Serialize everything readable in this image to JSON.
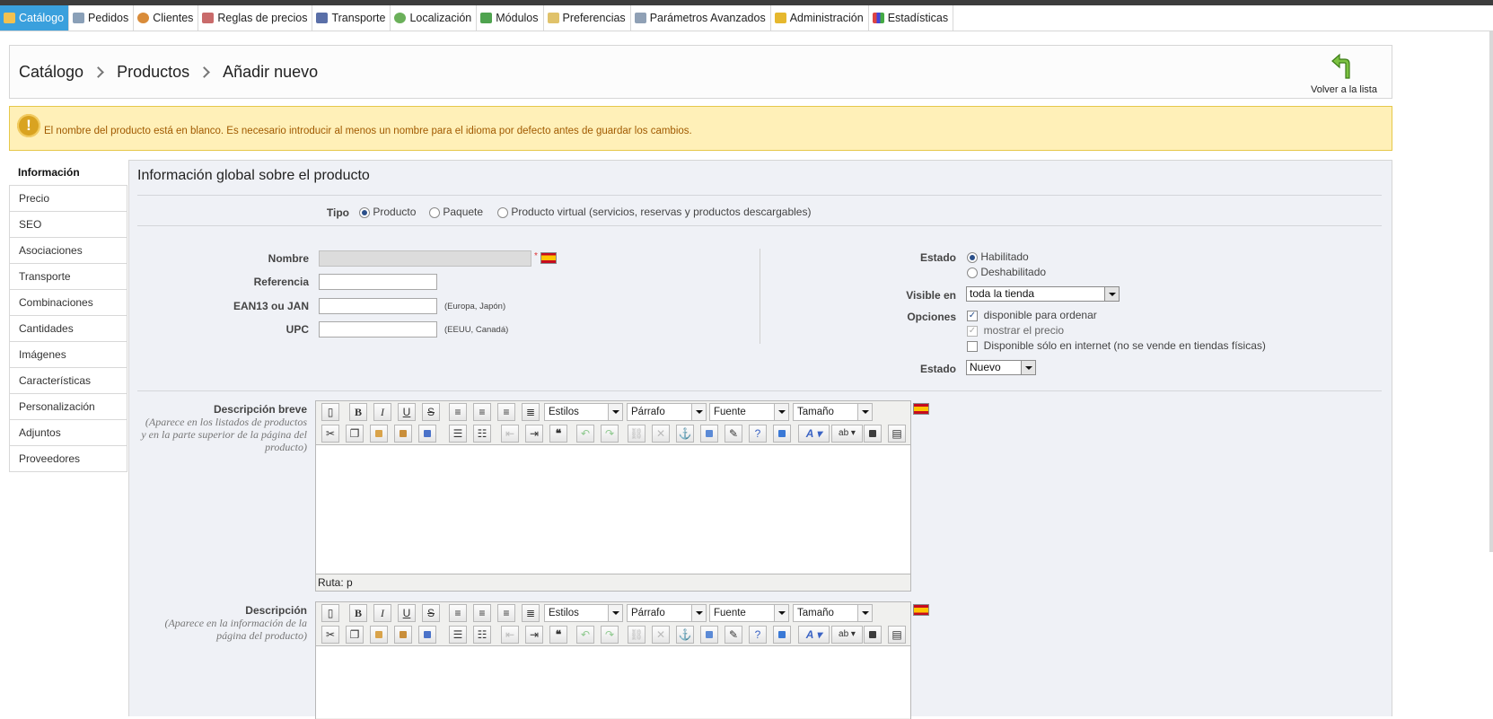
{
  "nav": {
    "items": [
      {
        "label": "Catálogo",
        "icon": "folder-icon",
        "active": true
      },
      {
        "label": "Pedidos",
        "icon": "cart-icon"
      },
      {
        "label": "Clientes",
        "icon": "user-icon"
      },
      {
        "label": "Reglas de precios",
        "icon": "price-rules-icon"
      },
      {
        "label": "Transporte",
        "icon": "truck-icon"
      },
      {
        "label": "Localización",
        "icon": "globe-icon"
      },
      {
        "label": "Módulos",
        "icon": "puzzle-icon"
      },
      {
        "label": "Preferencias",
        "icon": "preferences-icon"
      },
      {
        "label": "Parámetros Avanzados",
        "icon": "wrench-icon"
      },
      {
        "label": "Administración",
        "icon": "key-icon"
      },
      {
        "label": "Estadísticas",
        "icon": "stats-icon"
      }
    ]
  },
  "breadcrumb": [
    "Catálogo",
    "Productos",
    "Añadir nuevo"
  ],
  "back": {
    "label": "Volver a la lista",
    "icon": "back-arrow-icon"
  },
  "warning": {
    "text": "El nombre del producto está en blanco. Es necesario introducir al menos un nombre para el idioma por defecto antes de guardar los cambios.",
    "icon": "warning-icon"
  },
  "sidebar": [
    "Información",
    "Precio",
    "SEO",
    "Asociaciones",
    "Transporte",
    "Combinaciones",
    "Cantidades",
    "Imágenes",
    "Características",
    "Personalización",
    "Adjuntos",
    "Proveedores"
  ],
  "form": {
    "title": "Información global sobre el producto",
    "type": {
      "label": "Tipo",
      "options": [
        "Producto",
        "Paquete",
        "Producto virtual (servicios, reservas y productos descargables)"
      ],
      "selected": 0
    },
    "name": {
      "label": "Nombre",
      "value": "",
      "required": "*"
    },
    "reference": {
      "label": "Referencia",
      "value": ""
    },
    "ean": {
      "label": "EAN13 ou JAN",
      "value": "",
      "hint": "(Europa, Japón)"
    },
    "upc": {
      "label": "UPC",
      "value": "",
      "hint": "(EEUU, Canadá)"
    },
    "status": {
      "label": "Estado",
      "options": [
        "Habilitado",
        "Deshabilitado"
      ],
      "selected": 0
    },
    "visible": {
      "label": "Visible en",
      "value": "toda la tienda"
    },
    "options": {
      "label": "Opciones",
      "items": [
        {
          "label": "disponible para ordenar",
          "checked": true,
          "disabled": false
        },
        {
          "label": "mostrar el precio",
          "checked": true,
          "disabled": true
        },
        {
          "label": "Disponible sólo en internet (no se vende en tiendas físicas)",
          "checked": false,
          "disabled": false
        }
      ]
    },
    "condition": {
      "label": "Estado",
      "value": "Nuevo"
    },
    "short_desc": {
      "label": "Descripción breve",
      "sub": "(Aparece en los listados de productos y en la parte superior de la página del producto)",
      "path": "Ruta: p"
    },
    "desc": {
      "label": "Descripción",
      "sub": "(Aparece en la información de la página del producto)"
    }
  },
  "editor": {
    "selects": [
      "Estilos",
      "Párrafo",
      "Fuente",
      "Tamaño"
    ]
  },
  "colors": {
    "accent": "#3aa0dd",
    "warning_bg": "#fff0b8",
    "warning_text": "#a15a00",
    "panel_bg": "#eff1f6"
  }
}
